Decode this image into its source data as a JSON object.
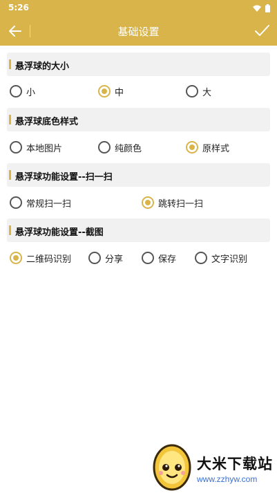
{
  "status": {
    "time": "5:26"
  },
  "header": {
    "title": "基础设置"
  },
  "sections": [
    {
      "title": "悬浮球的大小",
      "options": [
        "小",
        "中",
        "大"
      ],
      "selected": 1
    },
    {
      "title": "悬浮球底色样式",
      "options": [
        "本地图片",
        "纯颜色",
        "原样式"
      ],
      "selected": 2
    },
    {
      "title": "悬浮球功能设置--扫一扫",
      "options": [
        "常规扫一扫",
        "跳转扫一扫"
      ],
      "selected": 1
    },
    {
      "title": "悬浮球功能设置--截图",
      "options": [
        "二维码识别",
        "分享",
        "保存",
        "文字识别"
      ],
      "selected": 0
    }
  ],
  "watermark": {
    "name": "大米下载站",
    "url": "www.zzhyw.com"
  },
  "colors": {
    "accent": "#d9b44a"
  }
}
